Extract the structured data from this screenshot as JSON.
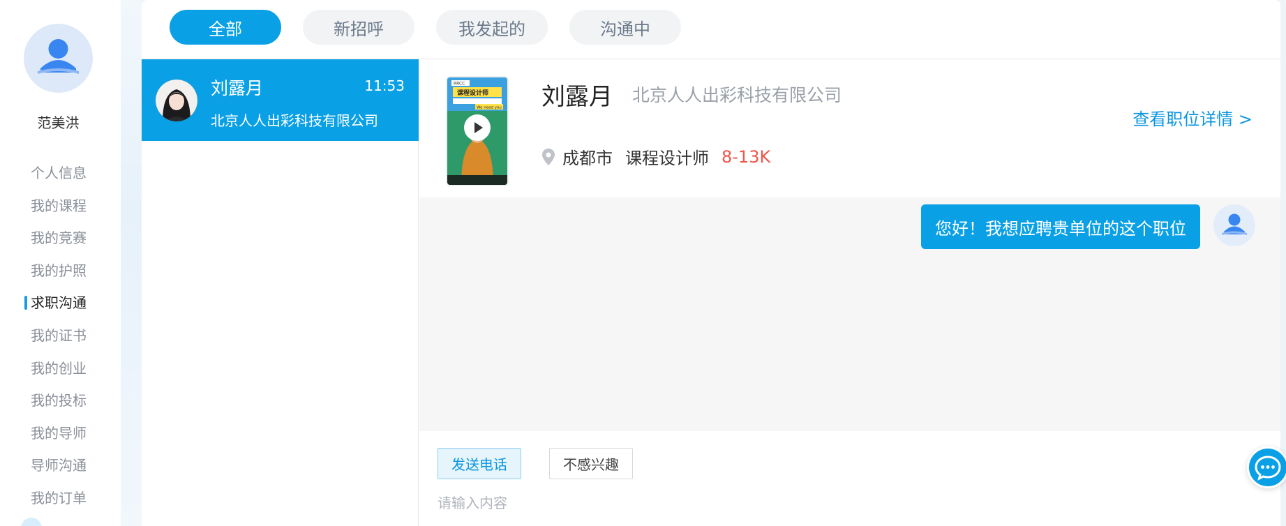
{
  "user": {
    "name": "范美洪"
  },
  "sidebar": {
    "items": [
      {
        "label": "个人信息",
        "active": false
      },
      {
        "label": "我的课程",
        "active": false
      },
      {
        "label": "我的竞赛",
        "active": false
      },
      {
        "label": "我的护照",
        "active": false
      },
      {
        "label": "求职沟通",
        "active": true
      },
      {
        "label": "我的证书",
        "active": false
      },
      {
        "label": "我的创业",
        "active": false
      },
      {
        "label": "我的投标",
        "active": false
      },
      {
        "label": "我的导师",
        "active": false
      },
      {
        "label": "导师沟通",
        "active": false
      },
      {
        "label": "我的订单",
        "active": false
      }
    ]
  },
  "tabs": [
    {
      "label": "全部",
      "active": true
    },
    {
      "label": "新招呼",
      "active": false
    },
    {
      "label": "我发起的",
      "active": false
    },
    {
      "label": "沟通中",
      "active": false
    }
  ],
  "conversations": [
    {
      "name": "刘露月",
      "time": "11:53",
      "company": "北京人人出彩科技有限公司",
      "selected": true
    }
  ],
  "job": {
    "contact_name": "刘露月",
    "company": "北京人人出彩科技有限公司",
    "detail_link": "查看职位详情 >",
    "city": "成都市",
    "title": "课程设计师",
    "salary": "8-13K",
    "thumbnail_text": {
      "badge": "RRCC",
      "heading": "课程设计师",
      "tag": "We need you"
    }
  },
  "messages": [
    {
      "from": "me",
      "text": "您好！我想应聘贵单位的这个职位"
    }
  ],
  "composer": {
    "send_phone_label": "发送电话",
    "not_interested_label": "不感兴趣",
    "placeholder": "请输入内容"
  },
  "colors": {
    "primary": "#0aa0e6",
    "salary": "#f0564a",
    "link": "#0a95e0"
  },
  "icons": [
    "user-avatar-icon",
    "location-pin-icon",
    "play-icon",
    "chat-support-icon"
  ]
}
